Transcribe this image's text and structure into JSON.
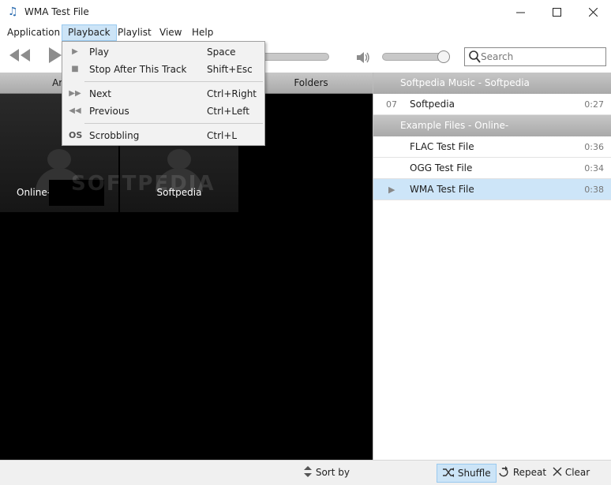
{
  "window": {
    "title": "WMA Test File"
  },
  "menubar": {
    "items": [
      "Application",
      "Playback",
      "Playlist",
      "View",
      "Help"
    ]
  },
  "playback_menu": {
    "items": [
      {
        "label": "Play",
        "shortcut": "Space",
        "icon": "play-icon"
      },
      {
        "label": "Stop After This Track",
        "shortcut": "Shift+Esc",
        "icon": "stop-icon"
      },
      {
        "label": "Next",
        "shortcut": "Ctrl+Right",
        "icon": "next-icon"
      },
      {
        "label": "Previous",
        "shortcut": "Ctrl+Left",
        "icon": "previous-icon"
      },
      {
        "label": "Scrobbling",
        "shortcut": "Ctrl+L",
        "icon": "lastfm-icon"
      }
    ]
  },
  "toolbar": {
    "search_placeholder": "Search",
    "seek_fraction": 0.9,
    "volume_fraction": 0.95
  },
  "library": {
    "tabs": [
      "Art",
      "Folders"
    ],
    "tiles": [
      {
        "label": "Online-"
      },
      {
        "label": "Softpedia"
      }
    ]
  },
  "playlist": {
    "groups": [
      {
        "header": "Softpedia Music - Softpedia",
        "tracks": [
          {
            "num": "07",
            "name": "Softpedia",
            "duration": "0:27",
            "playing": false
          }
        ]
      },
      {
        "header": "Example Files - Online-",
        "tracks": [
          {
            "num": "",
            "name": "FLAC Test File",
            "duration": "0:36",
            "playing": false
          },
          {
            "num": "",
            "name": "OGG Test File",
            "duration": "0:34",
            "playing": false
          },
          {
            "num": "",
            "name": "WMA Test File",
            "duration": "0:38",
            "playing": true
          }
        ]
      }
    ]
  },
  "statusbar": {
    "sort_label": "Sort by",
    "shuffle_label": "Shuffle",
    "repeat_label": "Repeat",
    "clear_label": "Clear"
  },
  "watermark": "SOFTPEDIA",
  "colors": {
    "accent": "#cce4f7",
    "accent_border": "#99c9ef",
    "header_gray": "#b0b0b0"
  }
}
